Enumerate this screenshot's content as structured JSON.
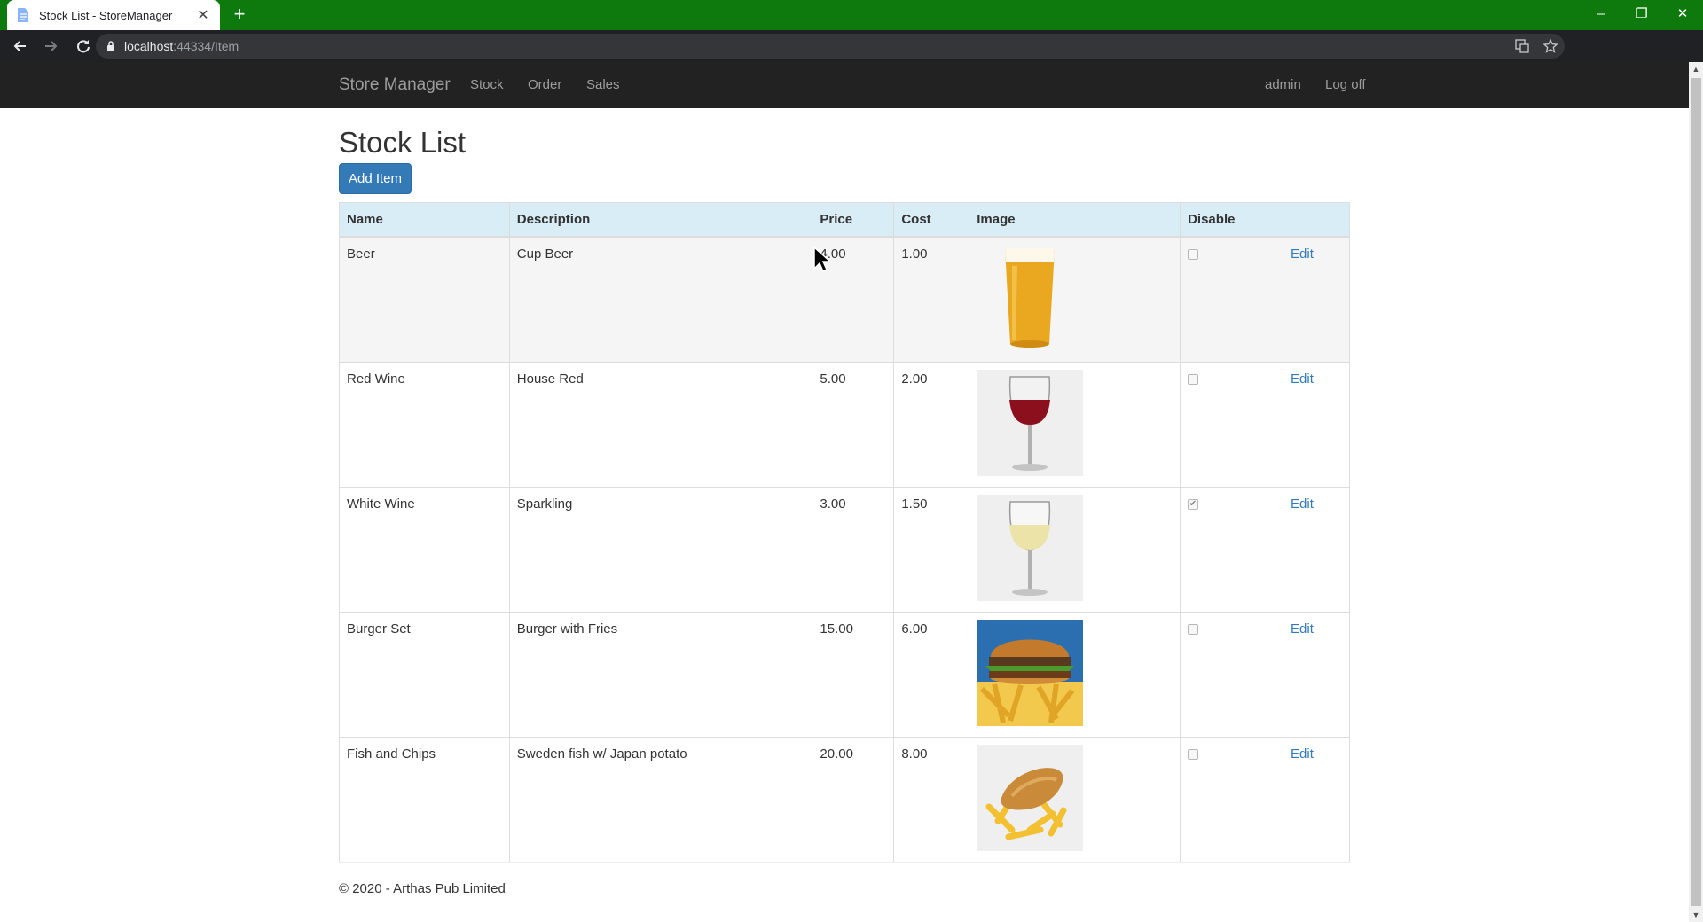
{
  "browser": {
    "tab_title": "Stock List - StoreManager",
    "url_host": "localhost",
    "url_rest": ":44334/Item",
    "new_tab_symbol": "+",
    "tab_close_symbol": "✕",
    "window_controls": [
      "–",
      "❐",
      "✕"
    ]
  },
  "navbar": {
    "brand": "Store Manager",
    "links": [
      "Stock",
      "Order",
      "Sales"
    ],
    "user": "admin",
    "logoff": "Log off",
    "background": "#222222",
    "link_color": "#9d9d9d"
  },
  "page": {
    "title": "Stock List",
    "add_button": "Add Item"
  },
  "table": {
    "headers": [
      "Name",
      "Description",
      "Price",
      "Cost",
      "Image",
      "Disable",
      ""
    ],
    "rows": [
      {
        "name": "Beer",
        "description": "Cup Beer",
        "price": "4.00",
        "cost": "1.00",
        "image": "beer-glass",
        "disabled": false,
        "action": "Edit"
      },
      {
        "name": "Red Wine",
        "description": "House Red",
        "price": "5.00",
        "cost": "2.00",
        "image": "red-wine-glass",
        "disabled": false,
        "action": "Edit"
      },
      {
        "name": "White Wine",
        "description": "Sparkling",
        "price": "3.00",
        "cost": "1.50",
        "image": "white-wine-glass",
        "disabled": true,
        "action": "Edit"
      },
      {
        "name": "Burger Set",
        "description": "Burger with Fries",
        "price": "15.00",
        "cost": "6.00",
        "image": "burger-with-fries",
        "disabled": false,
        "action": "Edit"
      },
      {
        "name": "Fish and Chips",
        "description": "Sweden fish w/ Japan potato",
        "price": "20.00",
        "cost": "8.00",
        "image": "fish-and-chips",
        "disabled": false,
        "action": "Edit"
      }
    ],
    "header_bg": "#d9edf7",
    "link_color": "#337ab7"
  },
  "footer": {
    "text": "© 2020 - Arthas Pub Limited"
  },
  "colors": {
    "titlebar": "#0e7a0d",
    "toolbar": "#202124",
    "button": "#337ab7"
  }
}
